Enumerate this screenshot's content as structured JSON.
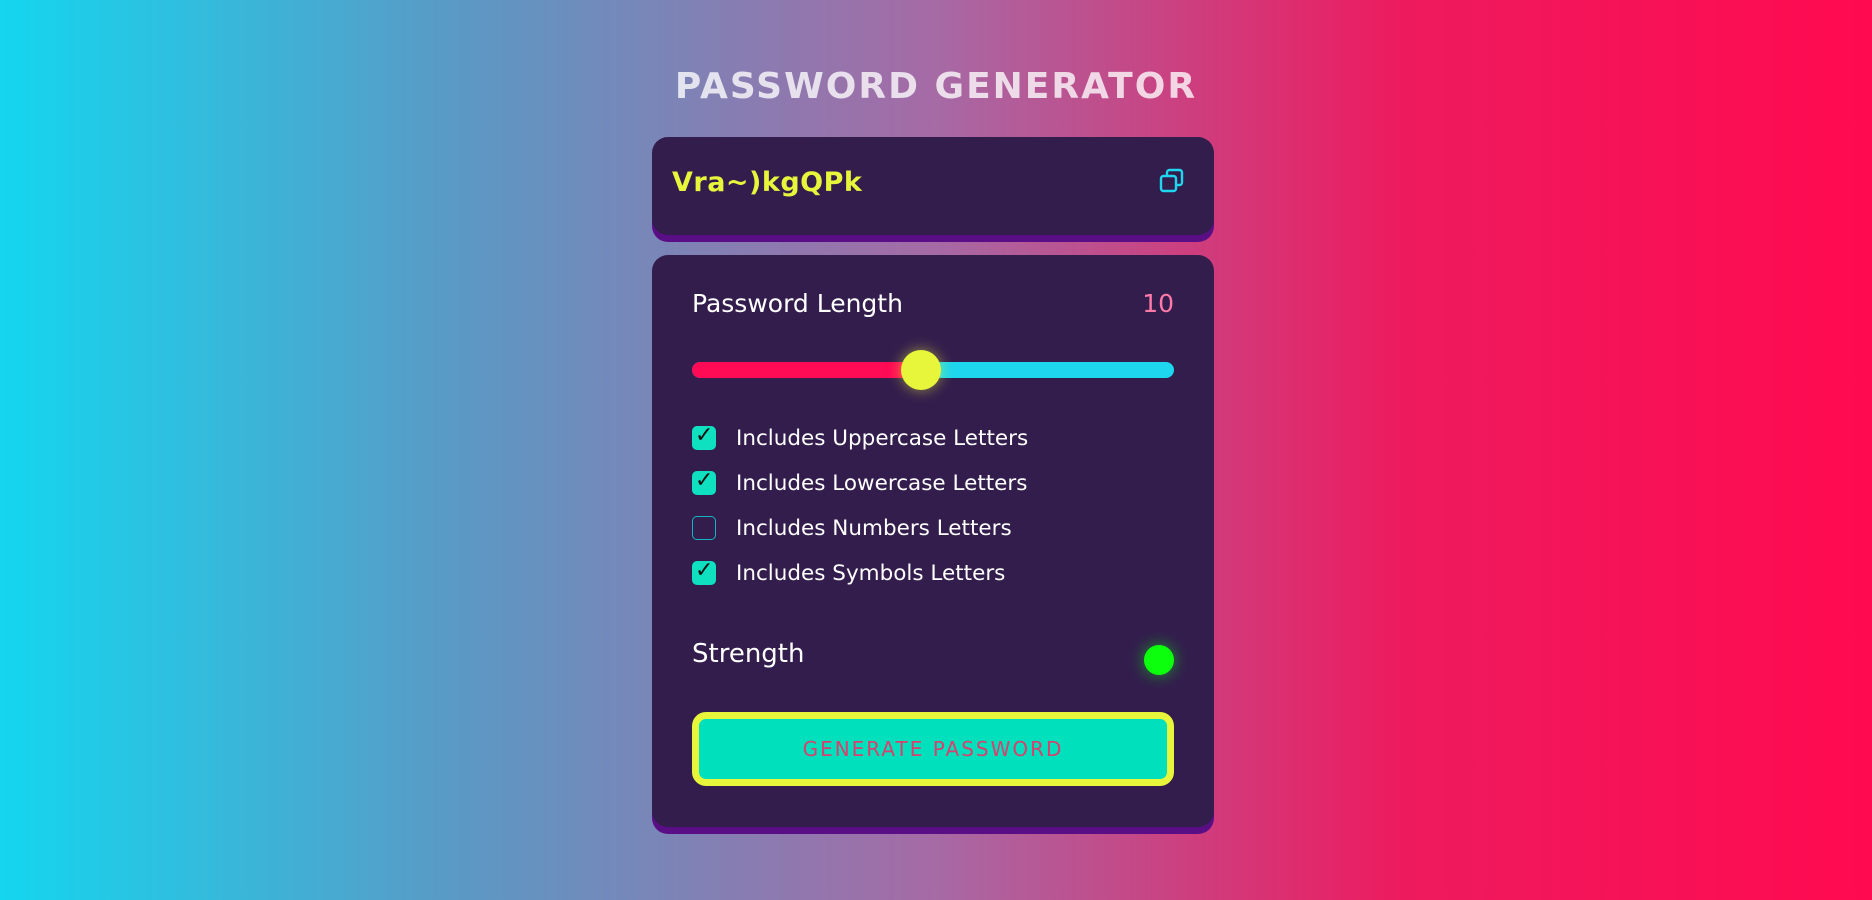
{
  "app": {
    "title": "PASSWORD GENERATOR"
  },
  "output": {
    "password": "Vra~)kgQPk",
    "copy_icon": "copy-icon"
  },
  "length": {
    "label": "Password Length",
    "value": "10",
    "slider_fraction": 0.475
  },
  "options": [
    {
      "label": "Includes Uppercase Letters",
      "checked": true
    },
    {
      "label": "Includes Lowercase Letters",
      "checked": true
    },
    {
      "label": "Includes Numbers Letters",
      "checked": false
    },
    {
      "label": "Includes Symbols Letters",
      "checked": true
    }
  ],
  "strength": {
    "label": "Strength",
    "indicator_color": "#0cff0c"
  },
  "generate": {
    "label": "GENERATE PASSWORD"
  },
  "colors": {
    "accent_yellow": "#e7f53b",
    "accent_teal": "#00e0bc",
    "accent_pink": "#ff0a55",
    "panel_bg": "#331d4d"
  }
}
